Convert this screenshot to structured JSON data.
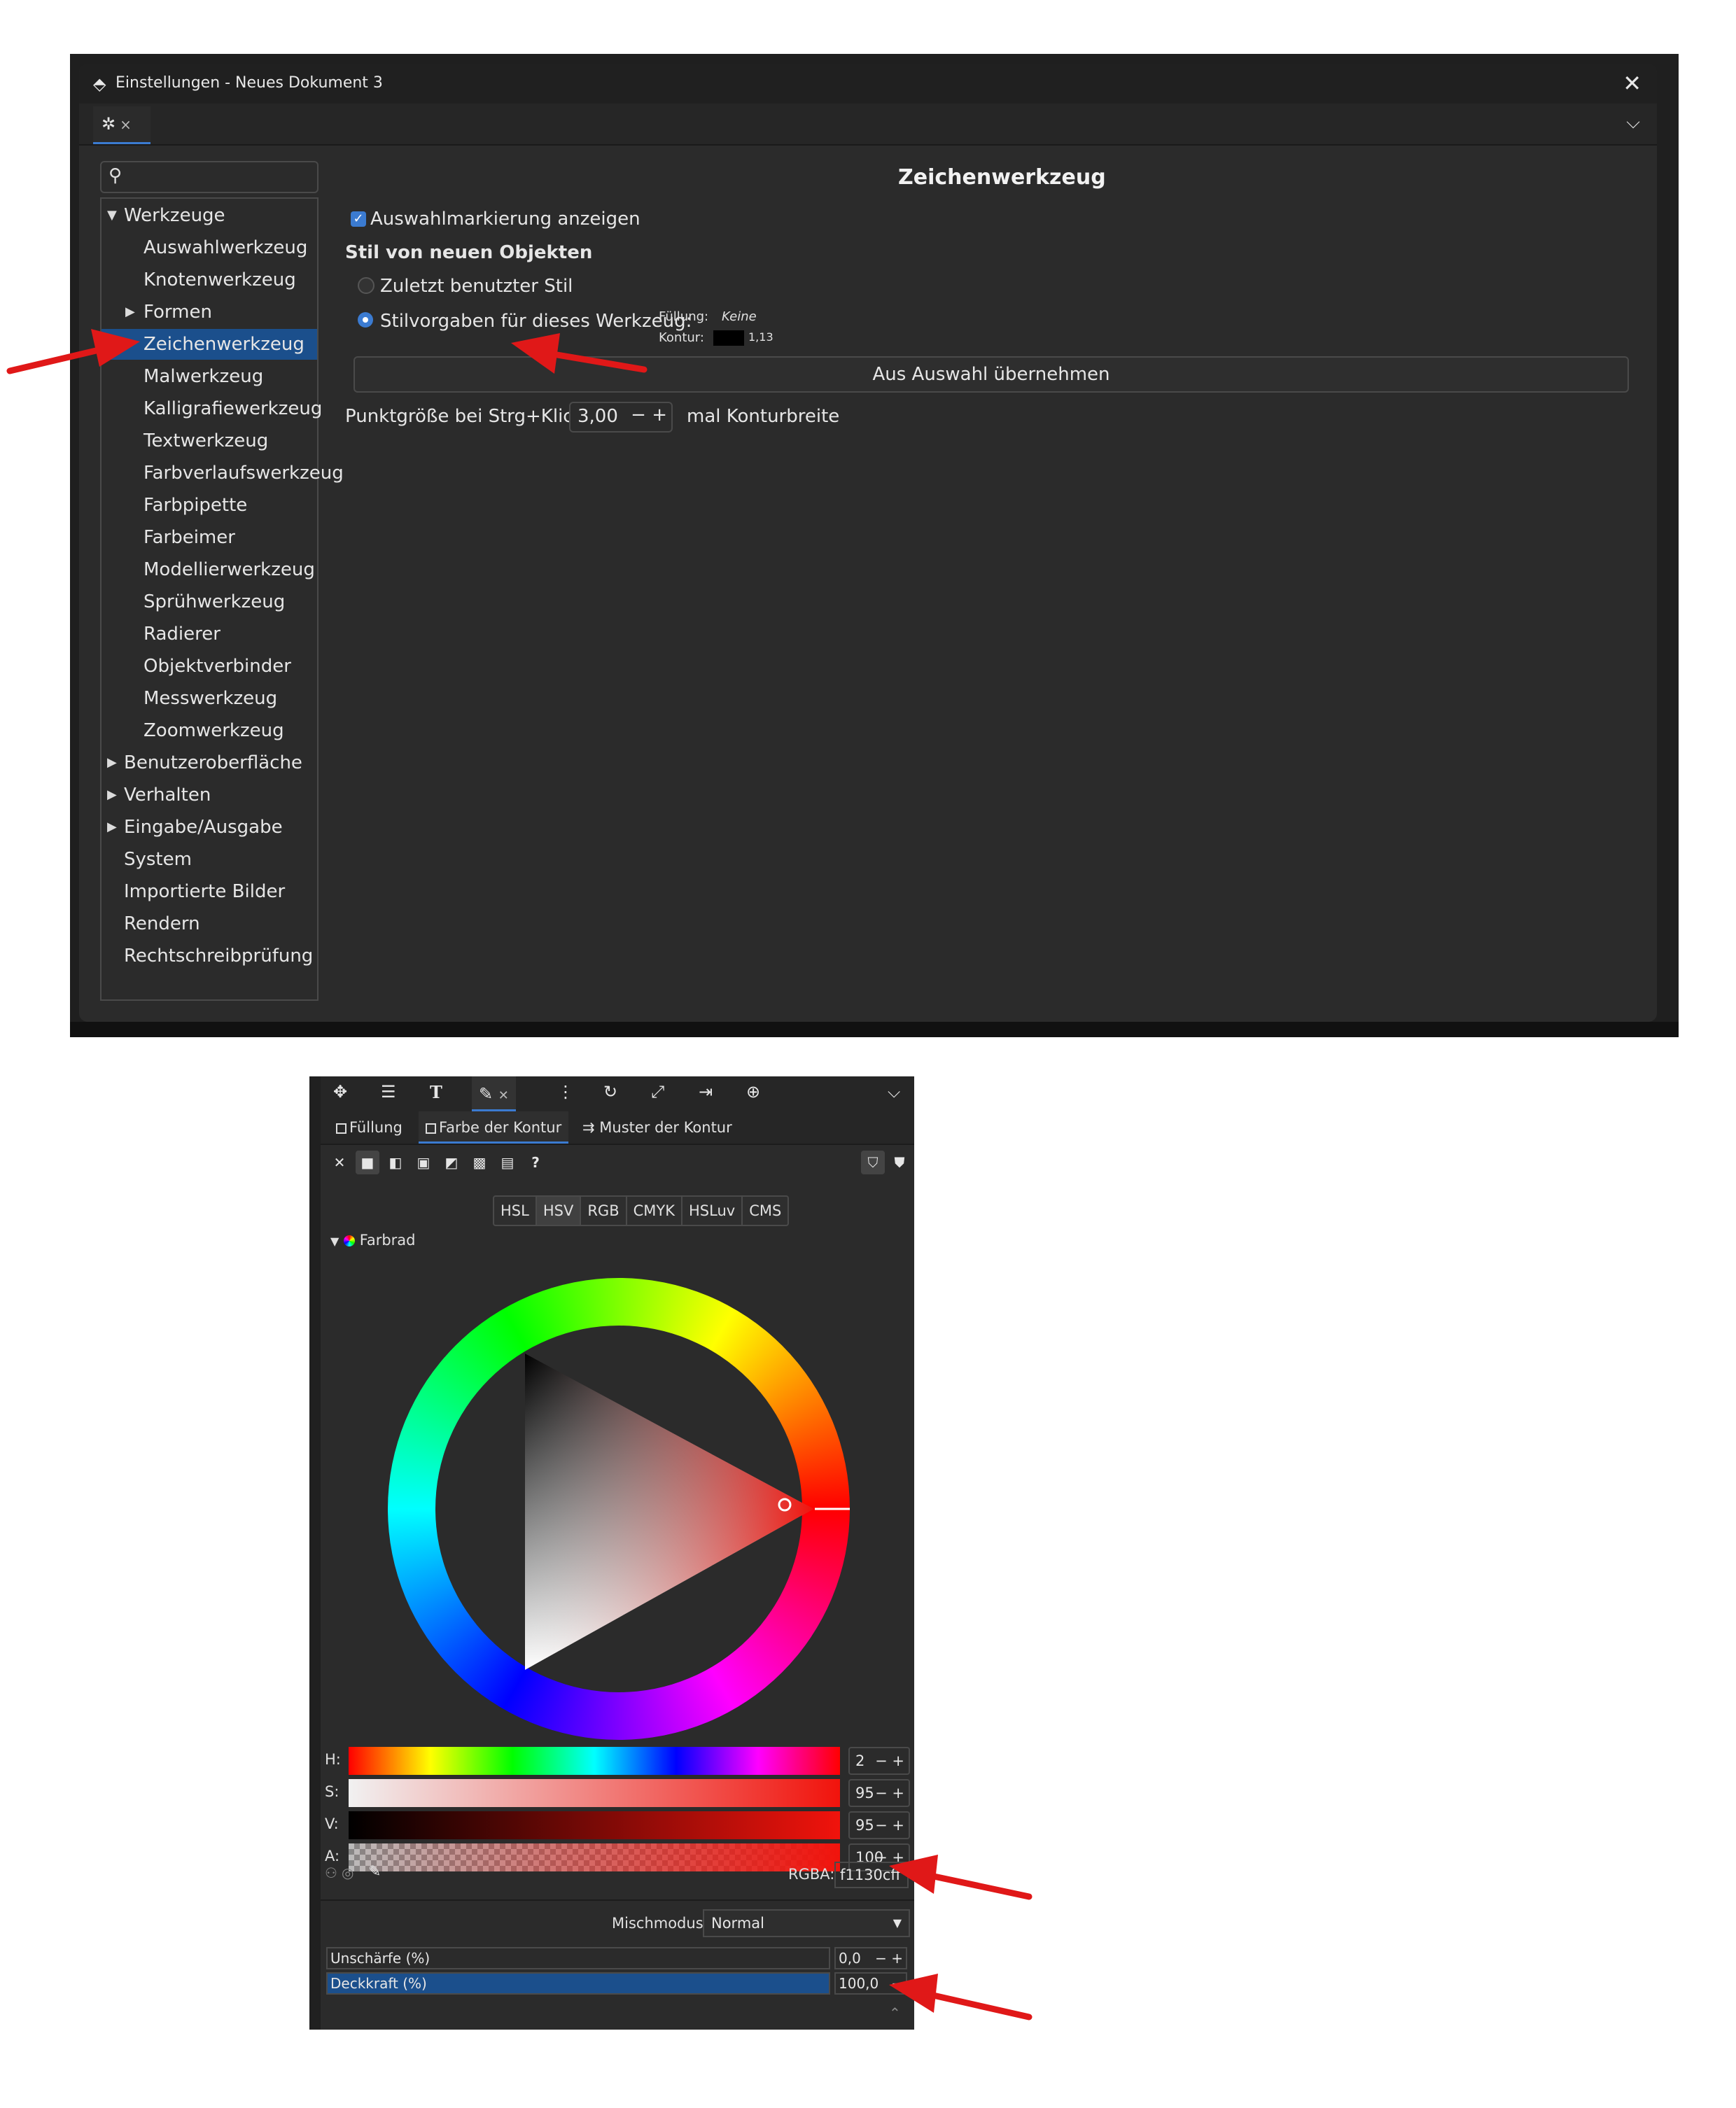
{
  "dialog": {
    "title": "Einstellungen - Neues Dokument 3",
    "tab_close": "×",
    "close": "✕",
    "chevron": "⌵"
  },
  "sidebar": {
    "items": [
      {
        "label": "Werkzeuge",
        "arrow": "▼"
      },
      {
        "label": "Auswahlwerkzeug"
      },
      {
        "label": "Knotenwerkzeug"
      },
      {
        "label": "Formen",
        "arrow": "▶"
      },
      {
        "label": "Zeichenwerkzeug",
        "selected": true
      },
      {
        "label": "Malwerkzeug"
      },
      {
        "label": "Kalligrafiewerkzeug"
      },
      {
        "label": "Textwerkzeug"
      },
      {
        "label": "Farbverlaufswerkzeug"
      },
      {
        "label": "Farbpipette"
      },
      {
        "label": "Farbeimer"
      },
      {
        "label": "Modellierwerkzeug"
      },
      {
        "label": "Sprühwerkzeug"
      },
      {
        "label": "Radierer"
      },
      {
        "label": "Objektverbinder"
      },
      {
        "label": "Messwerkzeug"
      },
      {
        "label": "Zoomwerkzeug"
      },
      {
        "label": "Benutzeroberfläche",
        "arrow": "▶"
      },
      {
        "label": "Verhalten",
        "arrow": "▶"
      },
      {
        "label": "Eingabe/Ausgabe",
        "arrow": "▶"
      },
      {
        "label": "System"
      },
      {
        "label": "Importierte Bilder"
      },
      {
        "label": "Rendern"
      },
      {
        "label": "Rechtschreibprüfung"
      }
    ]
  },
  "content": {
    "title": "Zeichenwerkzeug",
    "show_selection": "Auswahlmarkierung anzeigen",
    "style_heading": "Stil von neuen Objekten",
    "last_style": "Zuletzt benutzter Stil",
    "tool_style": "Stilvorgaben für dieses Werkzeug:",
    "fill_label": "Füllung:",
    "fill_value": "Keine",
    "stroke_label": "Kontur:",
    "stroke_width": "1,13",
    "from_selection": "Aus Auswahl übernehmen",
    "dot_size_label": "Punktgröße bei Strg+Klick:",
    "dot_size_value": "3,00",
    "dot_size_suffix": "mal Konturbreite",
    "spin_buttons": "− +"
  },
  "panel": {
    "tool_icons": [
      "node-icon",
      "align-icon",
      "text-icon",
      "fill-stroke-icon",
      "objects-icon",
      "transform-icon",
      "xml-icon",
      "export-icon",
      "symbols-icon"
    ],
    "text_tool": "T",
    "subtabs": {
      "fill": "Füllung",
      "stroke_paint": "Farbe der Kontur",
      "stroke_style": "Muster der Kontur"
    },
    "paint_unknown": "?",
    "modes": [
      "HSL",
      "HSV",
      "RGB",
      "CMYK",
      "HSLuv",
      "CMS"
    ],
    "selected_mode": "HSV",
    "wheel_label": "Farbrad",
    "sliders": [
      {
        "label": "H:",
        "value": "2"
      },
      {
        "label": "S:",
        "value": "95"
      },
      {
        "label": "V:",
        "value": "95"
      },
      {
        "label": "A:",
        "value": "100"
      }
    ],
    "rgba_label": "RGBA:",
    "rgba_value": "f1130cff",
    "blend_label": "Mischmodus:",
    "blend_value": "Normal",
    "blur_label": "Unschärfe (%)",
    "blur_value": "0,0",
    "opacity_label": "Deckkraft (%)",
    "opacity_value": "100,0"
  },
  "colors": {
    "accent": "#3b7bd1",
    "selection": "#1b4f8c",
    "current_color": "#f1130c",
    "annotation_arrow": "#e01818"
  }
}
